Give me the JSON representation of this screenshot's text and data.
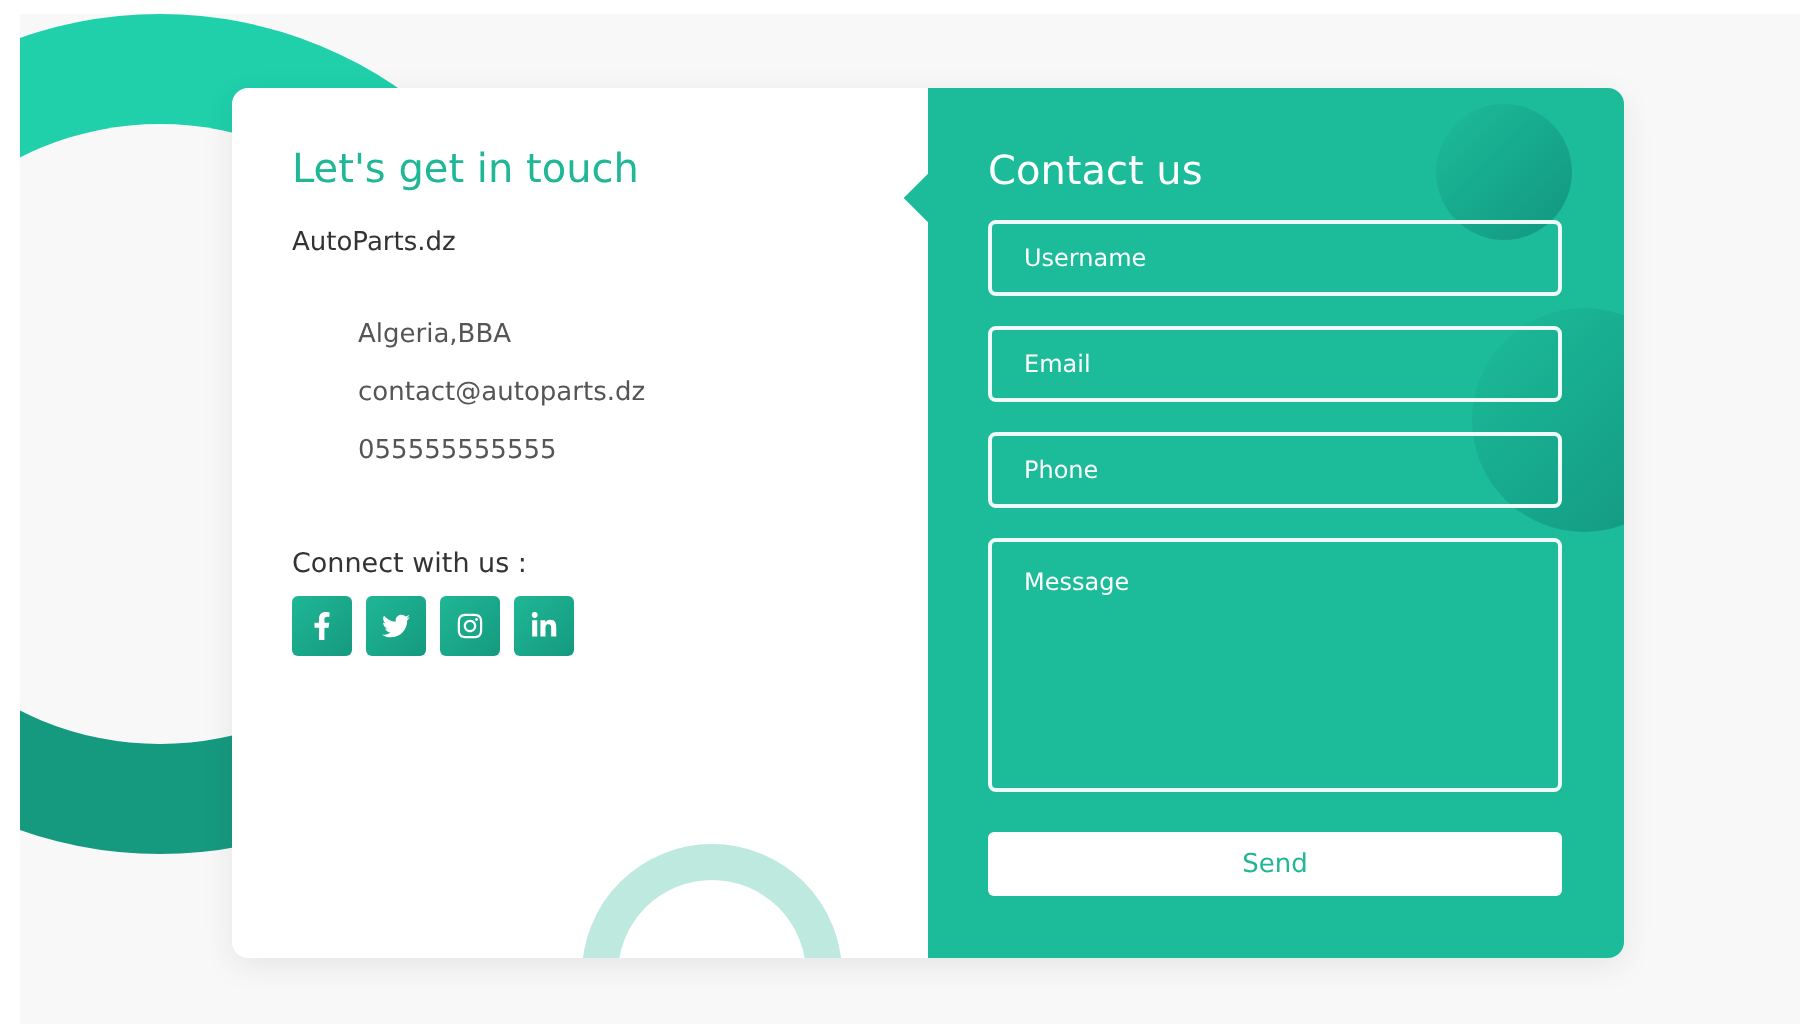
{
  "info_panel": {
    "title": "Let's get in touch",
    "brand": "AutoParts.dz",
    "details": [
      {
        "text": "Algeria,BBA"
      },
      {
        "text": "contact@autoparts.dz"
      },
      {
        "text": "055555555555"
      }
    ],
    "connect_label": "Connect with us :",
    "socials": [
      {
        "kind": "facebook"
      },
      {
        "kind": "twitter"
      },
      {
        "kind": "instagram"
      },
      {
        "kind": "linkedin"
      }
    ]
  },
  "form_panel": {
    "title": "Contact us",
    "fields": [
      {
        "kind": "input",
        "placeholder": "Username"
      },
      {
        "kind": "input",
        "placeholder": "Email"
      },
      {
        "kind": "input",
        "placeholder": "Phone"
      },
      {
        "kind": "textarea",
        "placeholder": "Message"
      }
    ],
    "submit": "Send"
  }
}
